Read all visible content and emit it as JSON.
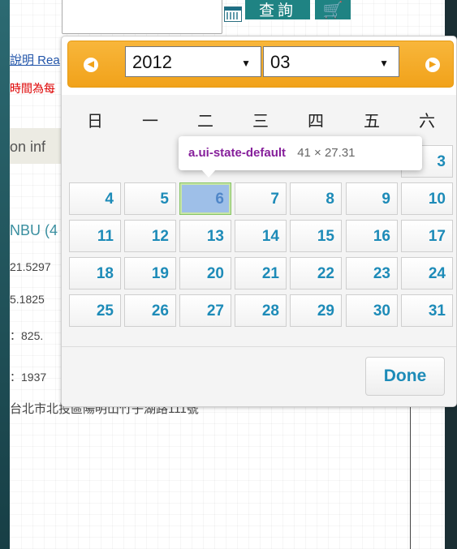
{
  "page": {
    "query_label": "查詢",
    "cart_icon": "🛒",
    "link_text": "說明 Rea",
    "red_note": "時間為每",
    "band_text": "on inf",
    "nbu_text": "NBU (4",
    "num1": "21.5297",
    "num2": "5.1825",
    "num3": "：825.",
    "num4": "：1937",
    "address": "台北市北投區陽明山竹子湖路111號"
  },
  "datepicker": {
    "prev_icon": "◀",
    "next_icon": "▶",
    "year": "2012",
    "month": "03",
    "weekdays": [
      "日",
      "一",
      "二",
      "三",
      "四",
      "五",
      "六"
    ],
    "days": [
      "3",
      "4",
      "5",
      "6",
      "7",
      "8",
      "9",
      "10",
      "11",
      "12",
      "13",
      "14",
      "15",
      "16",
      "17",
      "18",
      "19",
      "20",
      "21",
      "22",
      "23",
      "24",
      "25",
      "26",
      "27",
      "28",
      "29",
      "30",
      "31"
    ],
    "done_label": "Done"
  },
  "tooltip": {
    "selector": "a.ui-state-default",
    "size": "41 × 27.31"
  },
  "colors": {
    "accent": "#f1a21a",
    "day_text": "#1d8bb8",
    "highlight": "#9ebfe8"
  }
}
